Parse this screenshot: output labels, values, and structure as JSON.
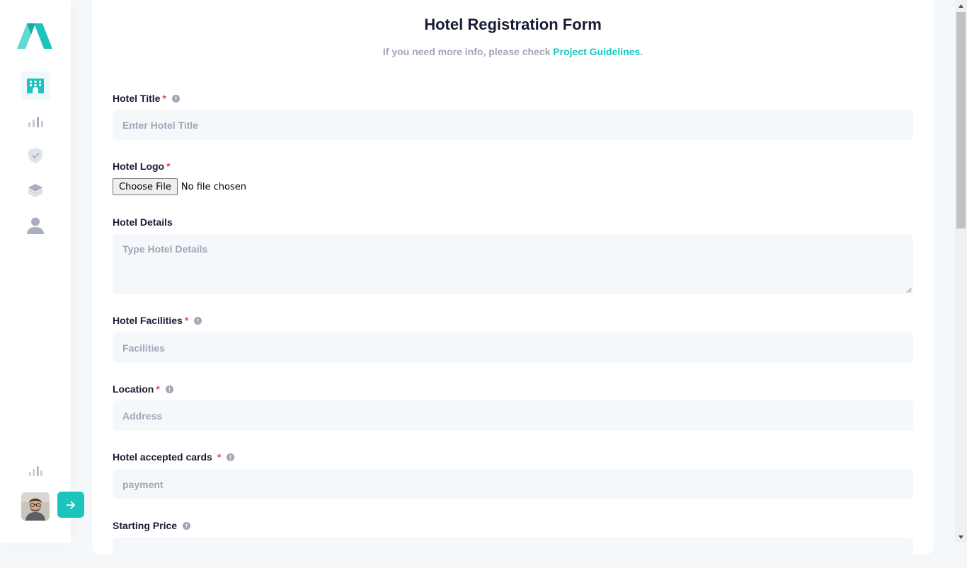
{
  "form": {
    "title": "Hotel Registration Form",
    "subtitle_prefix": "If you need more info, please check ",
    "guidelines_link": "Project Guidelines",
    "subtitle_suffix": ".",
    "required_marker": "*",
    "fields": {
      "hotel_title": {
        "label": "Hotel Title",
        "placeholder": "Enter Hotel Title"
      },
      "hotel_logo": {
        "label": "Hotel Logo",
        "button_label": "Choose File",
        "status": "No file chosen"
      },
      "hotel_details": {
        "label": "Hotel Details",
        "placeholder": "Type Hotel Details"
      },
      "hotel_facilities": {
        "label": "Hotel Facilities",
        "placeholder": "Facilities"
      },
      "location": {
        "label": "Location",
        "placeholder": "Address"
      },
      "accepted_cards": {
        "label": "Hotel accepted cards",
        "placeholder": "payment"
      },
      "starting_price": {
        "label": "Starting Price"
      }
    }
  },
  "sidebar": {
    "nav_items": [
      {
        "icon": "building-icon",
        "active": true
      },
      {
        "icon": "bar-chart-icon",
        "active": false
      },
      {
        "icon": "shield-check-icon",
        "active": false
      },
      {
        "icon": "layers-icon",
        "active": false
      },
      {
        "icon": "user-icon",
        "active": false
      }
    ],
    "bottom_icon": "bar-chart-icon",
    "action_icon": "arrow-right-icon"
  },
  "colors": {
    "accent": "#1bc5bd",
    "required": "#f1416c",
    "muted_text": "#a1a5b7",
    "input_bg": "#f5f8fa",
    "heading": "#181c32"
  }
}
